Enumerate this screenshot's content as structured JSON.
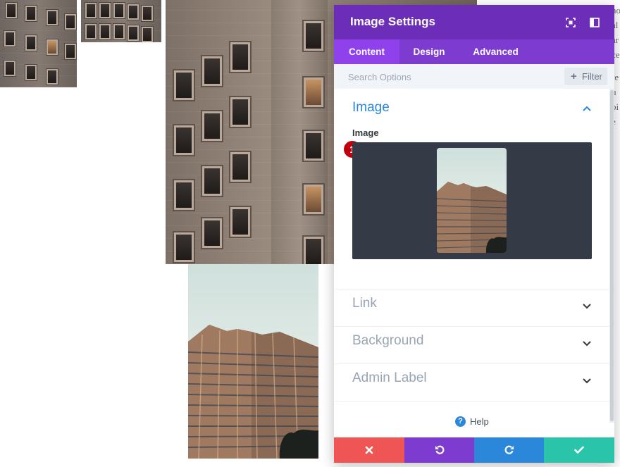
{
  "modal": {
    "title": "Image Settings",
    "header_icons": [
      "fullscreen-icon",
      "sidebar-toggle-icon"
    ],
    "tabs": [
      {
        "label": "Content",
        "active": true
      },
      {
        "label": "Design",
        "active": false
      },
      {
        "label": "Advanced",
        "active": false
      }
    ],
    "search": {
      "placeholder": "Search Options"
    },
    "filter": {
      "label": "Filter"
    },
    "sections": {
      "image": {
        "title": "Image",
        "expanded": true,
        "field_label": "Image",
        "badge": "1"
      },
      "link": {
        "title": "Link",
        "expanded": false
      },
      "background": {
        "title": "Background",
        "expanded": false
      },
      "admin_label": {
        "title": "Admin Label",
        "expanded": false
      }
    },
    "help": {
      "label": "Help"
    },
    "footer": {
      "cancel_icon": "close-icon",
      "undo_icon": "undo-icon",
      "redo_icon": "redo-icon",
      "save_icon": "check-icon"
    }
  },
  "colors": {
    "header": "#6c2eb9",
    "tabs": "#7e3bd0",
    "active_tab": "#8f42ec",
    "section_active": "#2b87da",
    "section_inactive": "#99a5b3",
    "cancel": "#ef5555",
    "undo": "#7d3bcf",
    "redo": "#2b87da",
    "save": "#29c4a9",
    "badge": "#c1000e"
  },
  "edge_text": [
    "no",
    "al",
    "ar",
    "ce",
    "",
    "re",
    "u",
    "pi",
    "e"
  ]
}
